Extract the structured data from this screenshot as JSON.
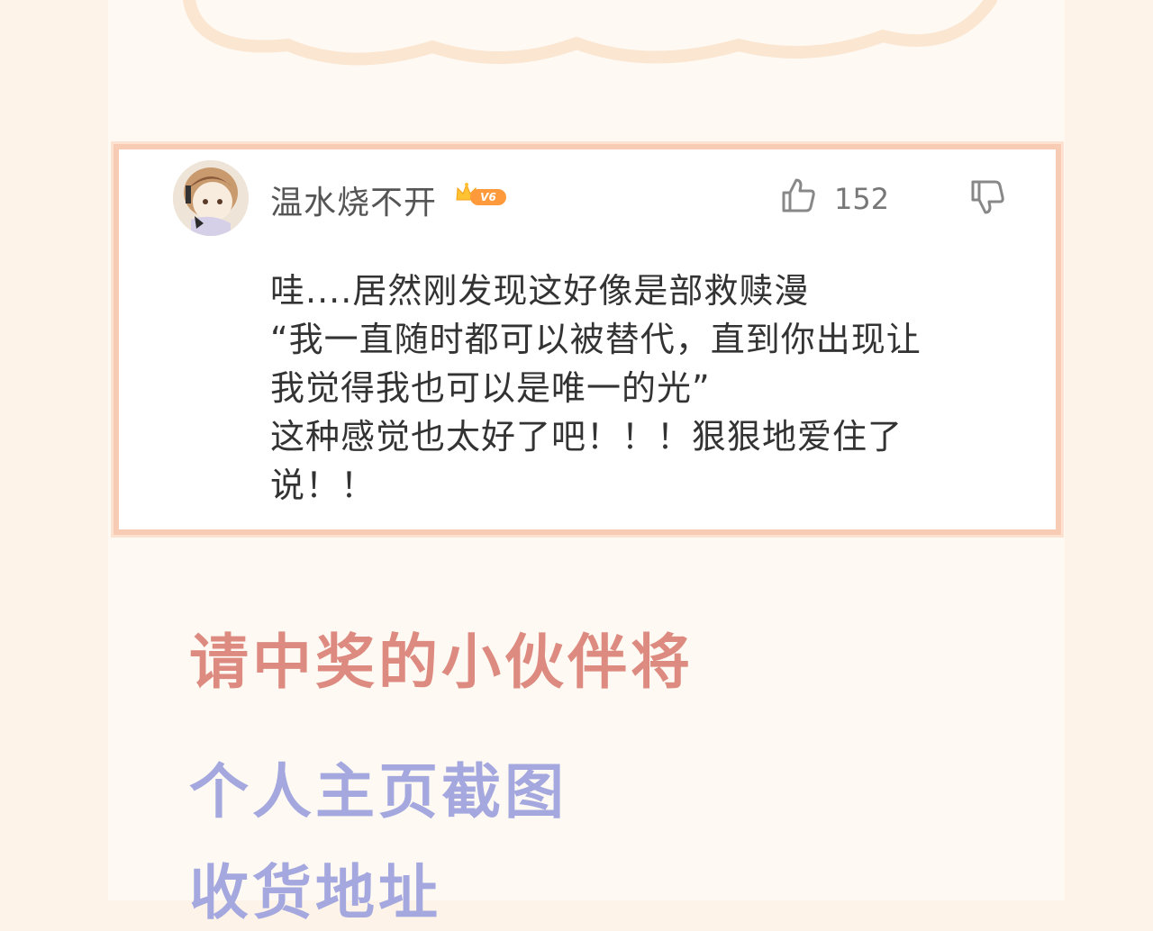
{
  "comment_card": {
    "username": "温水烧不开",
    "vip_level": "V6",
    "like_count": "152",
    "comment_lines": [
      "哇....居然刚发现这好像是部救赎漫",
      "“我一直随时都可以被替代，直到你出现让",
      "我觉得我也可以是唯一的光”",
      "这种感觉也太好了吧！！！狠狠地爱住了",
      "说！！"
    ]
  },
  "instructions": {
    "heading": "请中奖的小伙伴将",
    "item1": "个人主页截图",
    "item2": "收货地址"
  },
  "colors": {
    "page_background": "#fdf3e8",
    "card_border": "#f7cbb4",
    "heading_color": "#dd8b80",
    "item_color": "#a4a8de"
  },
  "icons": {
    "like": "thumbs-up-icon",
    "dislike": "thumbs-down-icon",
    "vip": "crown-icon"
  }
}
